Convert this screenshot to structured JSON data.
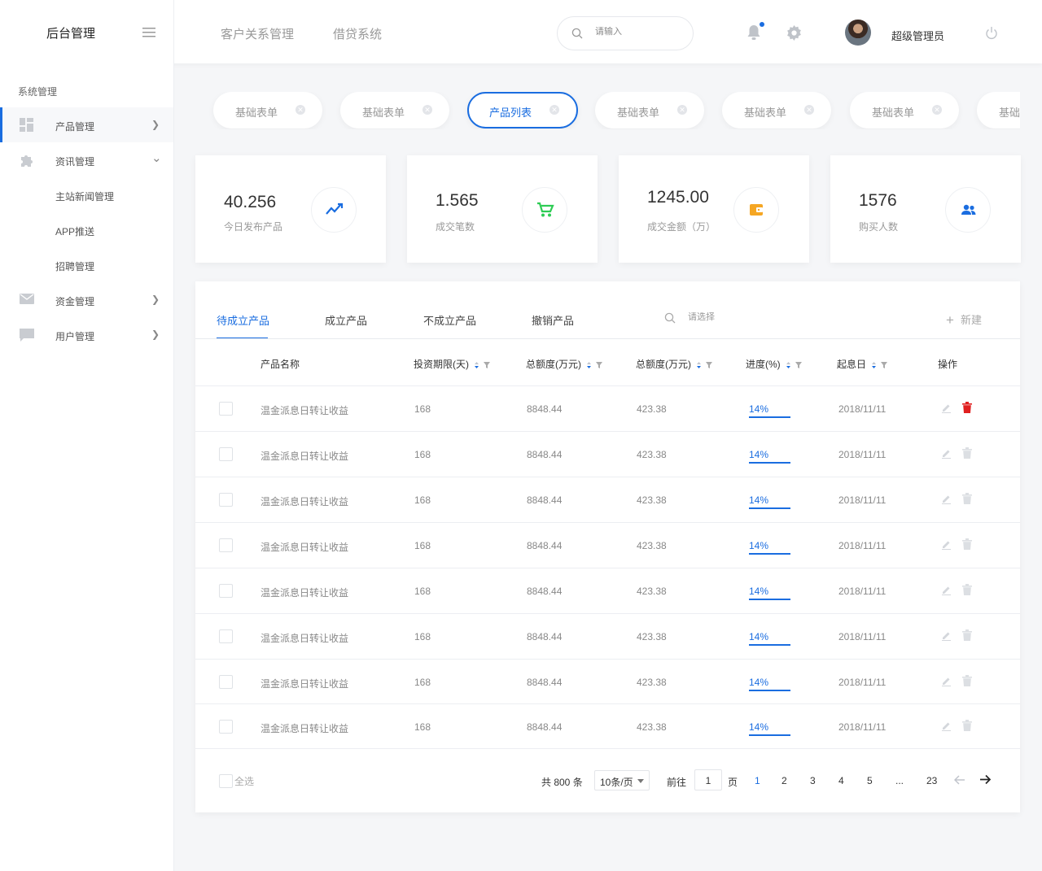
{
  "app": {
    "title": "后台管理"
  },
  "topnav": [
    "客户关系管理",
    "借贷系统"
  ],
  "search": {
    "placeholder": "请输入"
  },
  "user": {
    "name": "超级管理员"
  },
  "sidebar": {
    "section": "系统管理",
    "items": [
      {
        "label": "产品管理",
        "icon": "dashboard-icon",
        "chevron": "❯"
      },
      {
        "label": "资讯管理",
        "icon": "puzzle-icon",
        "chevron": "⌄"
      },
      {
        "label": "资金管理",
        "icon": "mail-icon",
        "chevron": "❯"
      },
      {
        "label": "用户管理",
        "icon": "chat-icon",
        "chevron": "❯"
      }
    ],
    "subitems": [
      "主站新闻管理",
      "APP推送",
      "招聘管理"
    ]
  },
  "pills": [
    {
      "label": "基础表单"
    },
    {
      "label": "基础表单"
    },
    {
      "label": "产品列表"
    },
    {
      "label": "基础表单"
    },
    {
      "label": "基础表单"
    },
    {
      "label": "基础表单"
    },
    {
      "label": "基础"
    }
  ],
  "stats": [
    {
      "value": "40.256",
      "caption": "今日发布产品",
      "icon": "trend-icon",
      "color": "#1a6de0"
    },
    {
      "value": "1.565",
      "caption": "成交笔数",
      "icon": "cart-icon",
      "color": "#2ecc54"
    },
    {
      "value": "1245.00",
      "caption": "成交金额（万）",
      "icon": "wallet-icon",
      "color": "#f5a623"
    },
    {
      "value": "1576",
      "caption": "购买人数",
      "icon": "users-icon",
      "color": "#1a6de0"
    }
  ],
  "panel": {
    "tabs": [
      "待成立产品",
      "成立产品",
      "不成立产品",
      "撤销产品"
    ],
    "search_placeholder": "请选择",
    "new_label": "新建",
    "new_icon": "+"
  },
  "table": {
    "columns": [
      "产品名称",
      "投资期限(天)",
      "总额度(万元)",
      "总额度(万元)",
      "进度(%)",
      "起息日",
      "操作"
    ],
    "rows": [
      {
        "name": "温金派息日转让收益",
        "term": "168",
        "total": "8848.44",
        "total2": "423.38",
        "progress": "14%",
        "date": "2018/11/11"
      },
      {
        "name": "温金派息日转让收益",
        "term": "168",
        "total": "8848.44",
        "total2": "423.38",
        "progress": "14%",
        "date": "2018/11/11"
      },
      {
        "name": "温金派息日转让收益",
        "term": "168",
        "total": "8848.44",
        "total2": "423.38",
        "progress": "14%",
        "date": "2018/11/11"
      },
      {
        "name": "温金派息日转让收益",
        "term": "168",
        "total": "8848.44",
        "total2": "423.38",
        "progress": "14%",
        "date": "2018/11/11"
      },
      {
        "name": "温金派息日转让收益",
        "term": "168",
        "total": "8848.44",
        "total2": "423.38",
        "progress": "14%",
        "date": "2018/11/11"
      },
      {
        "name": "温金派息日转让收益",
        "term": "168",
        "total": "8848.44",
        "total2": "423.38",
        "progress": "14%",
        "date": "2018/11/11"
      },
      {
        "name": "温金派息日转让收益",
        "term": "168",
        "total": "8848.44",
        "total2": "423.38",
        "progress": "14%",
        "date": "2018/11/11"
      },
      {
        "name": "温金派息日转让收益",
        "term": "168",
        "total": "8848.44",
        "total2": "423.38",
        "progress": "14%",
        "date": "2018/11/11"
      }
    ]
  },
  "pagination": {
    "select_all": "全选",
    "total": "共 800 条",
    "page_size": "10条/页",
    "goto": "前往",
    "goto_value": "1",
    "page_word": "页",
    "pages": [
      "1",
      "2",
      "3",
      "4",
      "5",
      "...",
      "23"
    ]
  },
  "colors": {
    "accent": "#1a6de0",
    "danger": "#e02020"
  }
}
